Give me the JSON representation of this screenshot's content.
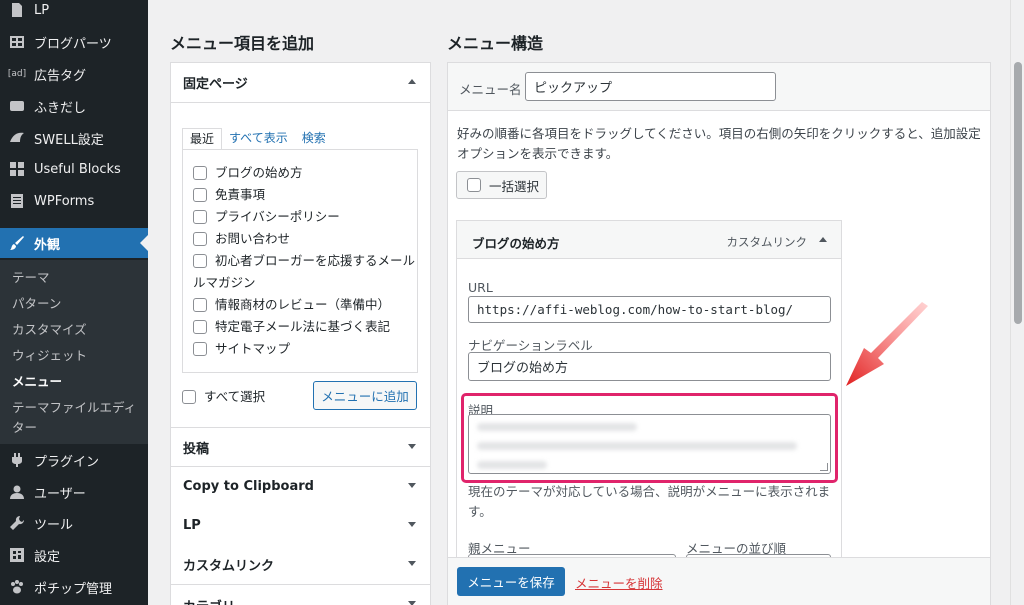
{
  "colors": {
    "accent": "#2271b1",
    "sidebar_bg": "#1d2327",
    "highlight_border": "#e0246b",
    "arrow_red": "#e02020"
  },
  "sidebar": {
    "items": [
      {
        "label": "LP",
        "icon": "page-icon"
      },
      {
        "label": "ブログパーツ",
        "icon": "grid-icon"
      },
      {
        "label": "広告タグ",
        "icon": "ad-icon"
      },
      {
        "label": "ふきだし",
        "icon": "speech-bubble-icon"
      },
      {
        "label": "SWELL設定",
        "icon": "swell-icon"
      },
      {
        "label": "Useful Blocks",
        "icon": "blocks-icon"
      },
      {
        "label": "WPForms",
        "icon": "form-icon"
      },
      {
        "label": "外観",
        "icon": "brush-icon"
      }
    ],
    "submenu": [
      "テーマ",
      "パターン",
      "カスタマイズ",
      "ウィジェット",
      "メニュー",
      "テーマファイルエディター"
    ],
    "lower_items": [
      {
        "label": "プラグイン",
        "icon": "plugin-icon"
      },
      {
        "label": "ユーザー",
        "icon": "user-icon"
      },
      {
        "label": "ツール",
        "icon": "wrench-icon"
      },
      {
        "label": "設定",
        "icon": "settings-icon"
      },
      {
        "label": "ポチップ管理",
        "icon": "paw-icon"
      }
    ]
  },
  "left": {
    "heading": "メニュー項目を追加",
    "fixed_pages": {
      "title": "固定ページ",
      "tabs": [
        "最近",
        "すべて表示",
        "検索"
      ],
      "pages": [
        "ブログの始め方",
        "免責事項",
        "プライバシーポリシー",
        "お問い合わせ",
        "初心者ブローガーを応援するメール",
        "情報商材のレビュー（準備中）",
        "特定電子メール法に基づく表記",
        "サイトマップ"
      ],
      "page_wrap": "ルマガジン",
      "select_all": "すべて選択",
      "add_button": "メニューに追加"
    },
    "sections": [
      "投稿",
      "Copy to Clipboard",
      "LP",
      "カスタムリンク",
      "カテゴリー"
    ]
  },
  "right": {
    "heading": "メニュー構造",
    "menu_name_label": "メニュー名",
    "menu_name_value": "ピックアップ",
    "instructions": "好みの順番に各項目をドラッグしてください。項目の右側の矢印をクリックすると、追加設定オプションを表示できます。",
    "bulk_select": "一括選択",
    "item": {
      "title": "ブログの始め方",
      "type": "カスタムリンク",
      "url_label": "URL",
      "url_value": "https://affi-weblog.com/how-to-start-blog/",
      "nav_label": "ナビゲーションラベル",
      "nav_value": "ブログの始め方",
      "desc_label": "説明",
      "desc_help": "現在のテーマが対応している場合、説明がメニューに表示されます。",
      "parent_label": "親メニュー",
      "order_label": "メニューの並び順"
    },
    "save_button": "メニューを保存",
    "delete_link": "メニューを削除"
  }
}
